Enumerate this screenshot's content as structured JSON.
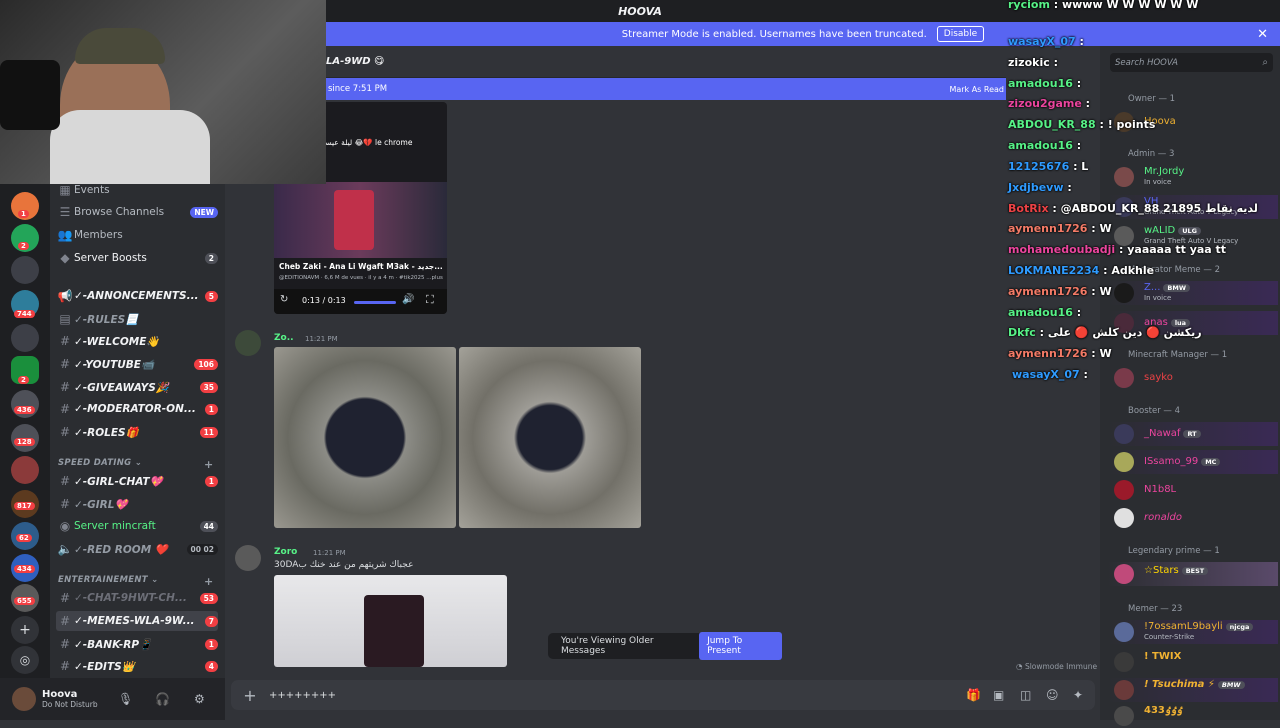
{
  "app": {
    "title": "HOOVA"
  },
  "banner": {
    "text": "Streamer Mode is enabled. Usernames have been truncated.",
    "button": "Disable"
  },
  "channel_header": {
    "title": "LA-9WD 😋"
  },
  "new_messages": {
    "text": "since 7:51 PM",
    "mark_read": "Mark As Read"
  },
  "sidebar": {
    "top_items": [
      {
        "label": "Events"
      },
      {
        "label": "Browse Channels",
        "badge": "NEW"
      },
      {
        "label": "Members"
      },
      {
        "label": "Server Boosts",
        "badge": "2"
      }
    ],
    "channels": [
      {
        "label": "✓-ANNONCEMENTS...",
        "badge": "5"
      },
      {
        "label": "✓-RULES📃",
        "badge": ""
      },
      {
        "label": "✓-WELCOME👋",
        "badge": ""
      },
      {
        "label": "✓-YOUTUBE📹",
        "badge": "106"
      },
      {
        "label": "✓-GIVEAWAYS🎉",
        "badge": "35"
      },
      {
        "label": "✓-MODERATOR-ON...",
        "badge": "1"
      },
      {
        "label": "✓-ROLES🎁",
        "badge": "11"
      }
    ],
    "cat_speed": "SPEED DATING",
    "speed_channels": [
      {
        "label": "✓-GIRL-CHAT💖",
        "badge": "1"
      },
      {
        "label": "✓-GIRL💖",
        "badge": ""
      },
      {
        "label": "Server mincraft",
        "badge": "44"
      },
      {
        "label": "✓-RED ROOM ❤️",
        "badge": "00 02"
      }
    ],
    "cat_ent": "ENTERTAINEMENT",
    "ent_channels": [
      {
        "label": "✓-CHAT-9HWT-CH...",
        "badge": "53"
      },
      {
        "label": "✓-MEMES-WLA-9W...",
        "badge": "7"
      },
      {
        "label": "✓-BANK-RP📱",
        "badge": "1"
      },
      {
        "label": "✓-EDITS👑",
        "badge": "4"
      }
    ],
    "guild_badges": [
      "1",
      "2",
      "744",
      "2",
      "436",
      "128",
      "817",
      "62",
      "434",
      "655"
    ]
  },
  "user": {
    "name": "Hoova",
    "status": "Do Not Disturb"
  },
  "video": {
    "caption_top": "ليلة عيسك 😂💔 le chrome",
    "title": "Cheb Zaki - Ana Li Wgaft M3ak - جديد...",
    "sub": "@EDITIONAVM · 6,6 M de vues · il y a 4 m · #tik2025 ...plus",
    "time": "0:13 / 0:13"
  },
  "messages": [
    {
      "author": "Zo..",
      "time": "11:21 PM",
      "color": "#57f287"
    },
    {
      "author": "Zoro",
      "time": "11:21 PM",
      "color": "#57f287",
      "text": "30DAعجباك شريتهم من عند خنك ب"
    }
  ],
  "older": {
    "text": "You're Viewing Older Messages",
    "jump": "Jump To Present"
  },
  "slowmode": "Slowmode Immune",
  "composer": {
    "value": "++++++++"
  },
  "members": {
    "search_placeholder": "Search HOOVA",
    "groups": [
      {
        "title": "Owner — 1",
        "items": [
          {
            "name": "Hoova",
            "sub": "",
            "color": "#f0b232"
          }
        ]
      },
      {
        "title": "Admin — 3",
        "items": [
          {
            "name": "Mr.Jordy",
            "sub": "In voice",
            "color": "#57f287"
          },
          {
            "name": "VH",
            "sub": "Grand Theft Auto V Legacy",
            "color": "#5865f2"
          },
          {
            "name": "wALID",
            "sub": "Grand Theft Auto V Legacy",
            "color": "#57f287",
            "tag": "ULG"
          }
        ]
      },
      {
        "title": "Moderator Meme — 2",
        "items": [
          {
            "name": "Z...",
            "sub": "In voice",
            "color": "#5865f2",
            "tag": "BMW"
          },
          {
            "name": "anas",
            "sub": "",
            "color": "#eb459e",
            "tag": "lua"
          }
        ]
      },
      {
        "title": "Minecraft Manager — 1",
        "items": [
          {
            "name": "sayko",
            "sub": "",
            "color": "#ed4245"
          }
        ]
      },
      {
        "title": "Booster — 4",
        "items": [
          {
            "name": "_Nawaf",
            "sub": "",
            "color": "#eb459e",
            "tag": "RT"
          },
          {
            "name": "ISsamo_99",
            "sub": "",
            "color": "#eb459e",
            "tag": "MC"
          },
          {
            "name": "N1b8L",
            "sub": "",
            "color": "#eb459e"
          },
          {
            "name": "ronaldo",
            "sub": "",
            "color": "#eb459e"
          }
        ]
      },
      {
        "title": "Legendary prime — 1",
        "items": [
          {
            "name": "☆Stars",
            "sub": "",
            "color": "#ffd700",
            "tag": "BEST"
          }
        ]
      },
      {
        "title": "Memer — 23",
        "items": [
          {
            "name": "!7ossamL9bayli",
            "sub": "Counter-Strike",
            "color": "#f0b232",
            "tag": "njcga"
          },
          {
            "name": "! TWIX",
            "sub": "",
            "color": "#f0b232"
          },
          {
            "name": "! Tsuchima ⚡",
            "sub": "",
            "color": "#f0b232",
            "tag": "BMW"
          },
          {
            "name": "433ٶٶٶ",
            "sub": "",
            "color": "#f0b232"
          }
        ]
      }
    ]
  },
  "twitch_chat": [
    {
      "user": "ryciom",
      "text": "wwww W W W W W W"
    },
    {
      "user": "wasayX_07",
      "text": ""
    },
    {
      "user": "zizokic",
      "text": ""
    },
    {
      "user": "amadou16",
      "text": ""
    },
    {
      "user": "zizou2game",
      "text": ""
    },
    {
      "user": "ABDOU_KR_88",
      "text": "! points"
    },
    {
      "user": "amadou16",
      "text": ""
    },
    {
      "user": "12125676",
      "text": "L"
    },
    {
      "user": "Jxdjbevw",
      "text": ""
    },
    {
      "user": "BotRix",
      "text": "@ABDOU_KR_88 21895 لديه نقاط"
    },
    {
      "user": "aymenn1726",
      "text": "W"
    },
    {
      "user": "mohamedoubadji",
      "text": "yaaaaa tt yaa tt"
    },
    {
      "user": "LOKMANE2234",
      "text": "Adkhle"
    },
    {
      "user": "aymenn1726",
      "text": "W"
    },
    {
      "user": "amadou16",
      "text": ""
    },
    {
      "user": "Dkfc",
      "text": "ريكشن 🔴 دين كلش 🔴 على"
    },
    {
      "user": "aymenn1726",
      "text": "W"
    },
    {
      "user": "wasayX_07",
      "text": ""
    }
  ]
}
